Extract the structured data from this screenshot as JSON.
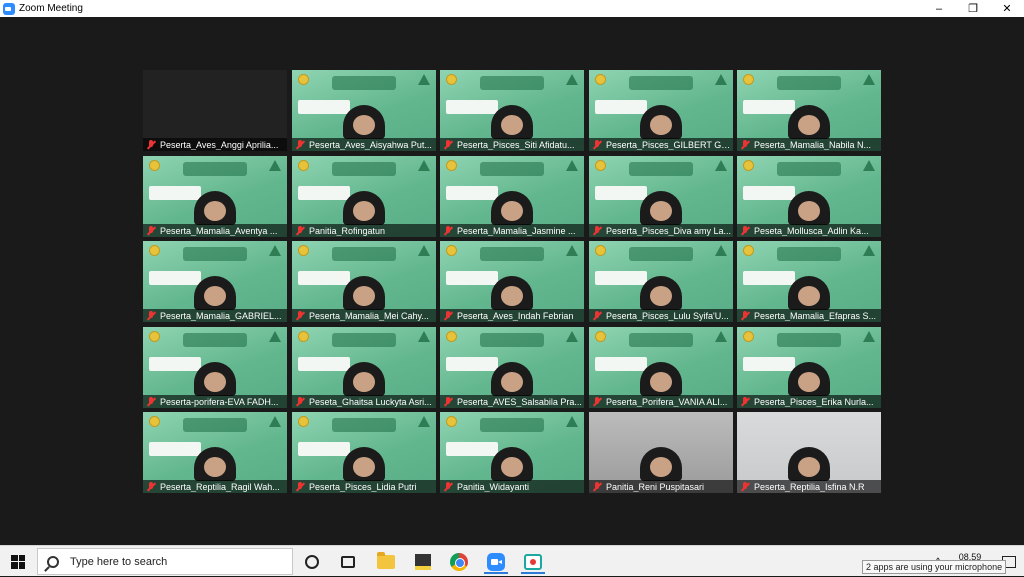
{
  "window": {
    "title": "Zoom Meeting",
    "minimize": "–",
    "restore": "❐",
    "close": "✕"
  },
  "participants": [
    {
      "name": "Peserta_Aves_Anggi Aprilia...",
      "bg": "dark"
    },
    {
      "name": "Peserta_Aves_Aisyahwa Put...",
      "bg": "green"
    },
    {
      "name": "Peserta_Pisces_Siti Afidatu...",
      "bg": "green"
    },
    {
      "name": "Peserta_Pisces_GILBERT GE...",
      "bg": "green"
    },
    {
      "name": "Peserta_Mamalia_Nabila N...",
      "bg": "green"
    },
    {
      "name": "Peserta_Mamalia_Aventya ...",
      "bg": "green"
    },
    {
      "name": "Panitia_Rofingatun",
      "bg": "green"
    },
    {
      "name": "Peserta_Mamalia_Jasmine ...",
      "bg": "green"
    },
    {
      "name": "Peserta_Pisces_Diva amy La...",
      "bg": "green"
    },
    {
      "name": "Peseta_Mollusca_Adlin Ka...",
      "bg": "green"
    },
    {
      "name": "Peserta_Mamalia_GABRIEL...",
      "bg": "green"
    },
    {
      "name": "Peserta_Mamalia_Mei Cahy...",
      "bg": "green"
    },
    {
      "name": "Peserta_Aves_Indah Febrian",
      "bg": "green"
    },
    {
      "name": "Peserta_Pisces_Lulu Syifa'U...",
      "bg": "green"
    },
    {
      "name": "Peserta_Mamalia_Efapras S...",
      "bg": "green"
    },
    {
      "name": "Peserta-porifera-EVA FADH...",
      "bg": "green"
    },
    {
      "name": "Peseta_Ghaitsa Luckyta Asri...",
      "bg": "green"
    },
    {
      "name": "Peserta_AVES_Salsabila Pra...",
      "bg": "green"
    },
    {
      "name": "Peserta_Porifera_VANIA ALI...",
      "bg": "green"
    },
    {
      "name": "Peserta_Pisces_Erika Nurla...",
      "bg": "green"
    },
    {
      "name": "Peserta_Reptilia_Ragil Wah...",
      "bg": "green"
    },
    {
      "name": "Peserta_Pisces_Lidia Putri",
      "bg": "green"
    },
    {
      "name": "Panitia_Widayanti",
      "bg": "green"
    },
    {
      "name": "Panitia_Reni Puspitasari",
      "bg": "gray"
    },
    {
      "name": "Peserta_Reptilia_Isfina N.R",
      "bg": "photo"
    }
  ],
  "taskbar": {
    "search_placeholder": "Type here to search",
    "clock_time": "08.59"
  },
  "tooltip": "2 apps are using your microphone"
}
